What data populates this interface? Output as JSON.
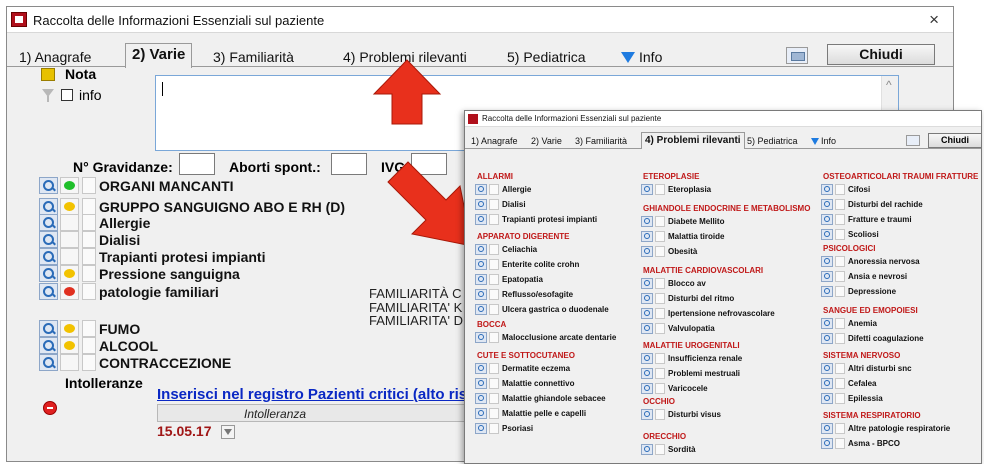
{
  "main": {
    "title": "Raccolta delle Informazioni Essenziali sul paziente",
    "close": "×",
    "tabs": [
      {
        "label": "1) Anagrafe"
      },
      {
        "label": "2) Varie"
      },
      {
        "label": "3) Familiarità"
      },
      {
        "label": "4) Problemi rilevanti"
      },
      {
        "label": "5) Pediatrica"
      },
      {
        "label": "Info"
      }
    ],
    "chiudi": "Chiudi",
    "nota_label": "Nota",
    "info_label": "info",
    "gravidanze_label": "N° Gravidanze:",
    "aborti_label": "Aborti spont.:",
    "ivg_label": "IVG:",
    "items": [
      {
        "label": "ORGANI MANCANTI",
        "dot": "green"
      },
      {
        "label": "GRUPPO SANGUIGNO ABO E RH (D)",
        "dot": "yellow"
      },
      {
        "label": "Allergie",
        "dot": "none"
      },
      {
        "label": "Dialisi",
        "dot": "none"
      },
      {
        "label": "Trapianti protesi impianti",
        "dot": "none"
      },
      {
        "label": "Pressione sanguigna",
        "dot": "yellow"
      },
      {
        "label": "patologie familiari",
        "dot": "red"
      }
    ],
    "familiarita": [
      "FAMILIARITÀ C",
      "FAMILIARITA' K",
      "FAMILIARITA' D"
    ],
    "items2": [
      {
        "label": "FUMO",
        "dot": "yellow"
      },
      {
        "label": "ALCOOL",
        "dot": "yellow"
      },
      {
        "label": "CONTRACCEZIONE",
        "dot": "none"
      }
    ],
    "intolleranze_label": "Intolleranze",
    "registro_link": "Inserisci nel registro  Pazienti critici (alto ris",
    "grid_header": "Intolleranza",
    "grid_date": "15.05.17"
  },
  "popup": {
    "title": "Raccolta delle Informazioni Essenziali sul paziente",
    "tabs": [
      {
        "label": "1) Anagrafe"
      },
      {
        "label": "2) Varie"
      },
      {
        "label": "3) Familiarità"
      },
      {
        "label": "4) Problemi rilevanti"
      },
      {
        "label": "5) Pediatrica"
      },
      {
        "label": "Info"
      }
    ],
    "chiudi": "Chiudi",
    "sections": {
      "allarmi": {
        "title": "ALLARMI",
        "items": [
          "Allergie",
          "Dialisi",
          "Trapianti protesi impianti"
        ]
      },
      "apparato": {
        "title": "APPARATO DIGERENTE",
        "items": [
          "Celiachia",
          "Enterite colite crohn",
          "Epatopatia",
          "Reflusso/esofagite",
          "Ulcera gastrica o duodenale"
        ]
      },
      "bocca": {
        "title": "BOCCA",
        "items": [
          "Malocclusione arcate dentarie"
        ]
      },
      "cute": {
        "title": "CUTE E SOTTOCUTANEO",
        "items": [
          "Dermatite eczema",
          "Malattie connettivo",
          "Malattie ghiandole sebacee",
          "Malattie pelle e capelli",
          "Psoriasi"
        ]
      },
      "eteroplasie": {
        "title": "ETEROPLASIE",
        "items": [
          "Eteroplasia"
        ]
      },
      "ghiandole": {
        "title": "GHIANDOLE ENDOCRINE E METABOLISMO",
        "items": [
          "Diabete Mellito",
          "Malattia tiroide",
          "Obesità"
        ]
      },
      "cardio": {
        "title": "MALATTIE CARDIOVASCOLARI",
        "items": [
          "Blocco av",
          "Disturbi del ritmo",
          "Ipertensione nefrovascolare",
          "Valvulopatia"
        ]
      },
      "uro": {
        "title": "MALATTIE UROGENITALI",
        "items": [
          "Insufficienza renale",
          "Problemi mestruali",
          "Varicocele"
        ]
      },
      "occhio": {
        "title": "OCCHIO",
        "items": [
          "Disturbi visus"
        ]
      },
      "orecchio": {
        "title": "ORECCHIO",
        "items": [
          "Sordità"
        ]
      },
      "osteo": {
        "title": "OSTEOARTICOLARI TRAUMI FRATTURE",
        "items": [
          "Cifosi",
          "Disturbi del rachide",
          "Fratture e traumi",
          "Scoliosi"
        ]
      },
      "psico": {
        "title": "PSICOLOGICI",
        "items": [
          "Anoressia nervosa",
          "Ansia e nevrosi",
          "Depressione"
        ]
      },
      "sangue": {
        "title": "SANGUE ED EMOPOIESI",
        "items": [
          "Anemia",
          "Difetti coagulazione"
        ]
      },
      "nervoso": {
        "title": "SISTEMA NERVOSO",
        "items": [
          "Altri disturbi snc",
          "Cefalea",
          "Epilessia"
        ]
      },
      "respiratorio": {
        "title": "SISTEMA RESPIRATORIO",
        "items": [
          "Altre patologie respiratorie",
          "Asma - BPCO"
        ]
      }
    }
  },
  "colors": {
    "section_red": "#c01818",
    "arrow_red": "#e8301c",
    "dot_green": "#1fbf2a",
    "dot_yellow": "#f2c200",
    "dot_red": "#e03020",
    "link_blue": "#0a28c4"
  },
  "icons": [
    "app-icon",
    "close-icon",
    "info-icon",
    "magnifier-icon",
    "filter-icon",
    "stop-icon"
  ]
}
